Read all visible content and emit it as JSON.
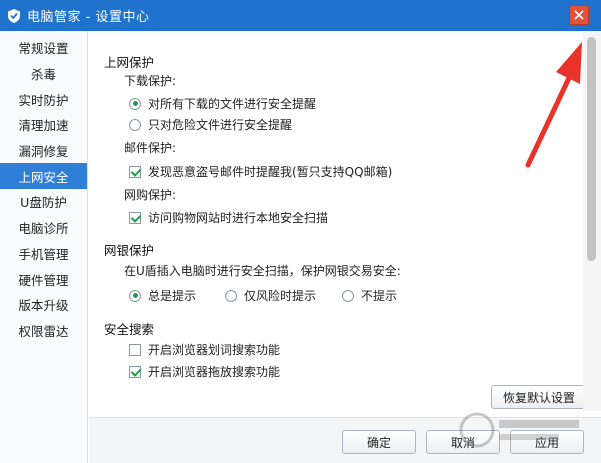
{
  "window": {
    "title": "电脑管家 - 设置中心",
    "tooltip": "关"
  },
  "sidebar": {
    "items": [
      {
        "label": "常规设置"
      },
      {
        "label": "杀毒"
      },
      {
        "label": "实时防护"
      },
      {
        "label": "清理加速"
      },
      {
        "label": "漏洞修复"
      },
      {
        "label": "上网安全",
        "active": true
      },
      {
        "label": "U盘防护"
      },
      {
        "label": "电脑诊所"
      },
      {
        "label": "手机管理"
      },
      {
        "label": "硬件管理"
      },
      {
        "label": "版本升级"
      },
      {
        "label": "权限雷达"
      }
    ]
  },
  "content": {
    "web_protection": {
      "title": "上网保护",
      "download": {
        "label": "下载保护:",
        "opt_all": "对所有下载的文件进行安全提醒",
        "opt_danger": "只对危险文件进行安全提醒",
        "selected": "all"
      },
      "mail": {
        "label": "邮件保护:",
        "opt": "发现恶意盗号邮件时提醒我(暂只支持QQ邮箱)",
        "checked": true
      },
      "shopping": {
        "label": "网购保护:",
        "opt": "访问购物网站时进行本地安全扫描",
        "checked": true
      }
    },
    "bank_protection": {
      "title": "网银保护",
      "desc": "在U盾插入电脑时进行安全扫描，保护网银交易安全:",
      "opt_always": "总是提示",
      "opt_risk": "仅风险时提示",
      "opt_never": "不提示",
      "selected": "always"
    },
    "safe_search": {
      "title": "安全搜索",
      "opt_select": "开启浏览器划词搜索功能",
      "opt_drag": "开启浏览器拖放搜索功能",
      "select_checked": false,
      "drag_checked": true
    },
    "restore_label": "恢复默认设置"
  },
  "footer": {
    "ok": "确定",
    "cancel": "取消",
    "apply": "应用"
  },
  "colors": {
    "titlebar": "#1f73cc",
    "active_nav": "#2f7fd6",
    "check_green": "#1aa04a",
    "close_red": "#e0523a",
    "annotation_arrow": "#e8322a"
  }
}
